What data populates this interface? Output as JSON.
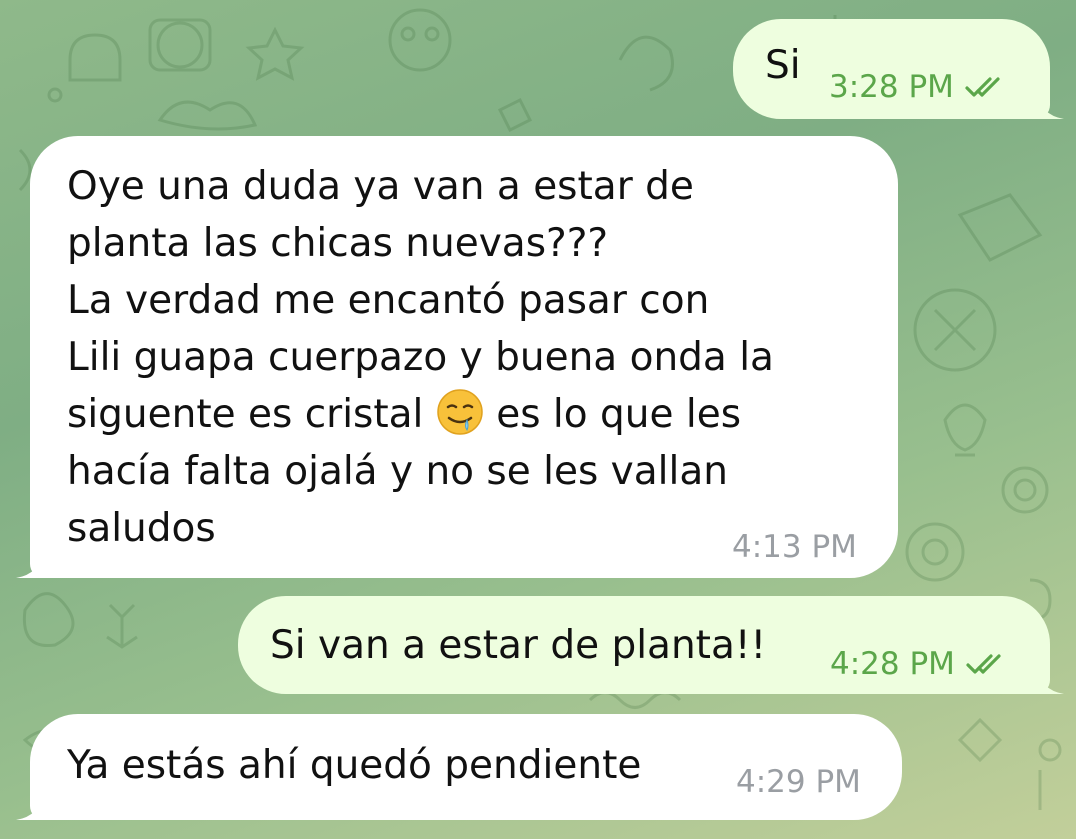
{
  "chat": {
    "colors": {
      "outgoing_bubble": "#eefedf",
      "incoming_bubble": "#ffffff",
      "outgoing_time": "#5ba64a",
      "incoming_time": "#9a9ea3",
      "read_checks": "#5ba64a"
    },
    "messages": [
      {
        "direction": "outgoing",
        "text": "Si",
        "time": "3:28 PM",
        "status_icon": "double-check-icon"
      },
      {
        "direction": "incoming",
        "text_lines": [
          "Oye una duda ya van a estar de",
          "planta las chicas nuevas???",
          "La verdad me encantó pasar con",
          "Lili guapa cuerpazo y buena onda la",
          "siguente es cristal",
          "es lo que les",
          "hacía falta ojalá y no se les vallan",
          "saludos"
        ],
        "emoji": "drooling-face-emoji",
        "time": "4:13 PM"
      },
      {
        "direction": "outgoing",
        "text": "Si van a estar de planta!!",
        "time": "4:28 PM",
        "status_icon": "double-check-icon"
      },
      {
        "direction": "incoming",
        "text": "Ya estás ahí quedó pendiente",
        "time": "4:29 PM"
      }
    ]
  }
}
